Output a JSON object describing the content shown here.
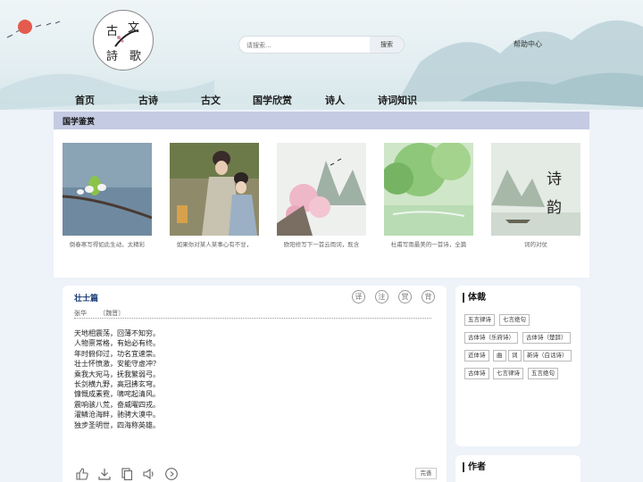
{
  "header": {
    "logo_chars": [
      "古",
      "文",
      "詩",
      "歌"
    ],
    "search": {
      "placeholder": "请搜索...",
      "button": "搜索"
    },
    "help_link": "帮助中心"
  },
  "nav": [
    "首页",
    "古诗",
    "古文",
    "国学欣赏",
    "诗人",
    "诗词知识"
  ],
  "appreciation": {
    "title": "国学鉴赏",
    "cards": [
      {
        "caption": "倒春寒写得如此生动，太精彩"
      },
      {
        "caption": "如果你对某人某事心有不甘，"
      },
      {
        "caption": "欧阳修写下一首云雨词，既含"
      },
      {
        "caption": "杜甫写雨最美的一首诗，全篇"
      },
      {
        "caption": "词的对仗",
        "overlay": [
          "诗",
          "韵"
        ]
      }
    ]
  },
  "poem": {
    "title": "壮士篇",
    "tools": [
      "译",
      "注",
      "赏",
      "背"
    ],
    "author": "张华",
    "dynasty": "〔魏晋〕",
    "lines": [
      "天地相震荡，回薄不知穷。",
      "人物禀常格，有始必有终。",
      "年时俯仰过，功名宜速崇。",
      "壮士怀愤激，安能守虚冲？",
      "乘我大宛马，抚我繁弱弓。",
      "长剑横九野，高冠拂玄穹。",
      "慷慨成素霓，啸咤起清风。",
      "震响骇八荒，奋威曜四戎。",
      "濯鳞沧海畔，驰骋大漠中。",
      "独步圣明世，四海称英雄。"
    ],
    "actions": [
      "like-icon",
      "download-icon",
      "copy-icon",
      "audio-icon",
      "play-icon"
    ],
    "finish_label": "完善"
  },
  "sidebar": {
    "genres": {
      "title": "体裁",
      "tags": [
        "五言律诗",
        "七言绝句",
        "古体诗（乐府诗）",
        "古体诗（楚辞）",
        "近体诗",
        "曲",
        "词",
        "新诗（白话诗）",
        "古体诗",
        "七言律诗",
        "五言绝句"
      ]
    },
    "authors": {
      "title": "作者"
    }
  }
}
